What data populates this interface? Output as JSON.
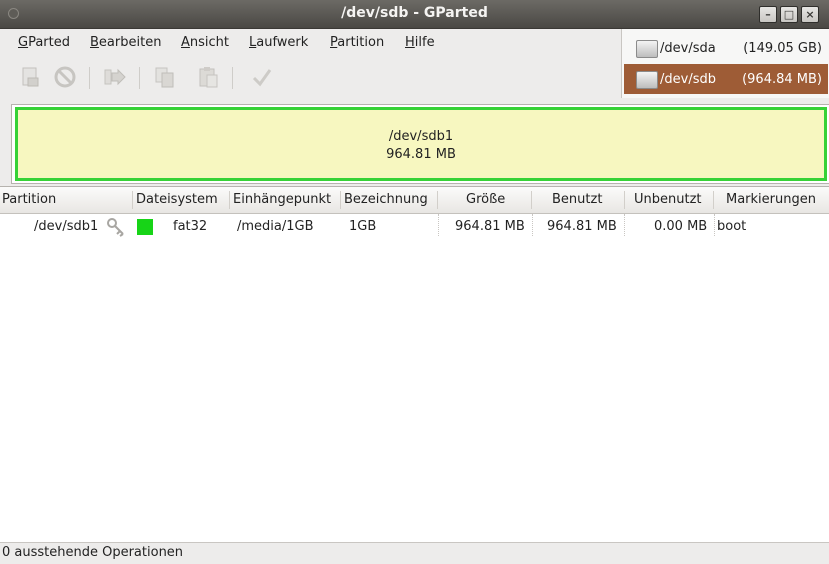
{
  "window": {
    "title": "/dev/sdb - GParted"
  },
  "menu": {
    "items": [
      {
        "label": "GParted",
        "mnemonic": "G"
      },
      {
        "label": "Bearbeiten",
        "mnemonic": "B"
      },
      {
        "label": "Ansicht",
        "mnemonic": "A"
      },
      {
        "label": "Laufwerk",
        "mnemonic": "L"
      },
      {
        "label": "Partition",
        "mnemonic": "P"
      },
      {
        "label": "Hilfe",
        "mnemonic": "H"
      }
    ]
  },
  "toolbar": {
    "buttons": [
      {
        "icon": "new-partition-icon",
        "enabled": false
      },
      {
        "icon": "delete-partition-icon",
        "enabled": false
      },
      {
        "icon": "resize-move-icon",
        "enabled": false
      },
      {
        "icon": "copy-icon",
        "enabled": false
      },
      {
        "icon": "paste-icon",
        "enabled": false
      },
      {
        "icon": "apply-icon",
        "enabled": false
      }
    ]
  },
  "devices": [
    {
      "name": "/dev/sda",
      "size": "(149.05 GB)",
      "selected": false
    },
    {
      "name": "/dev/sdb",
      "size": "(964.84 MB)",
      "selected": true
    }
  ],
  "visual": {
    "partition_name": "/dev/sdb1",
    "partition_size": "964.81 MB",
    "border_color": "#36d236",
    "fill_color": "#f7f7c0"
  },
  "table": {
    "headers": [
      "Partition",
      "Dateisystem",
      "Einhängepunkt",
      "Bezeichnung",
      "Größe",
      "Benutzt",
      "Unbenutzt",
      "Markierungen"
    ],
    "rows": [
      {
        "partition": "/dev/sdb1",
        "filesystem": "fat32",
        "filesystem_color": "#17d417",
        "mountpoint": "/media/1GB",
        "label": "1GB",
        "size": "964.81 MB",
        "used": "964.81 MB",
        "unused": "0.00 MB",
        "flags": "boot",
        "icon": "key-icon"
      }
    ]
  },
  "status": {
    "pending": "0 ausstehende Operationen"
  }
}
